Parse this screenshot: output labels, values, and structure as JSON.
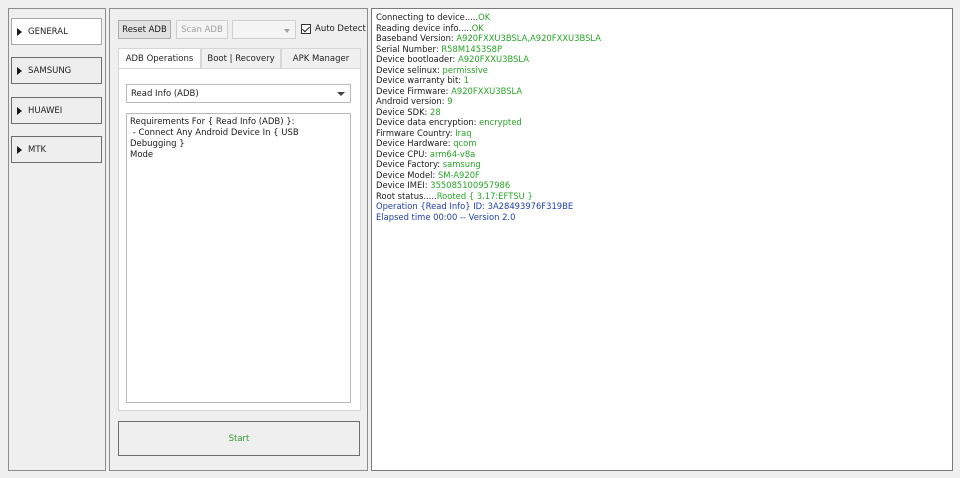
{
  "sidebar": {
    "items": [
      {
        "label": "GENERAL"
      },
      {
        "label": "SAMSUNG"
      },
      {
        "label": "HUAWEI"
      },
      {
        "label": "MTK"
      }
    ]
  },
  "toolbar": {
    "reset_adb": "Reset ADB",
    "scan_adb": "Scan ADB",
    "port_select_value": "",
    "auto_detect_label": "Auto Detect",
    "auto_detect_checked": true
  },
  "tabs": [
    {
      "label": "ADB Operations"
    },
    {
      "label": "Boot | Recovery"
    },
    {
      "label": "APK Manager"
    }
  ],
  "operation": {
    "selected": "Read Info (ADB)",
    "requirements": "Requirements For { Read Info (ADB) }:\n - Connect Any Android Device In { USB Debugging }\nMode"
  },
  "start_button": "Start",
  "colors": {
    "value_green": "#27a427",
    "info_blue": "#1e3fa8",
    "start_green": "#2e9b2e"
  },
  "log": {
    "lines": [
      {
        "label": "Connecting to device.....",
        "value": "OK"
      },
      {
        "label": "Reading device info.....",
        "value": "OK"
      },
      {
        "label": "Baseband Version: ",
        "value": "A920FXXU3BSLA,A920FXXU3BSLA"
      },
      {
        "label": "Serial Number: ",
        "value": "R58M1453S8P"
      },
      {
        "label": "Device bootloader: ",
        "value": "A920FXXU3BSLA"
      },
      {
        "label": "Device selinux: ",
        "value": "permissive"
      },
      {
        "label": "Device warranty bit: ",
        "value": "1"
      },
      {
        "label": "Device Firmware: ",
        "value": "A920FXXU3BSLA"
      },
      {
        "label": "Android version: ",
        "value": "9"
      },
      {
        "label": "Device SDK: ",
        "value": "28"
      },
      {
        "label": "Device data encryption: ",
        "value": "encrypted"
      },
      {
        "label": "Firmware Country: ",
        "value": "Iraq"
      },
      {
        "label": "Device Hardware: ",
        "value": "qcom"
      },
      {
        "label": "Device CPU: ",
        "value": "arm64-v8a"
      },
      {
        "label": "Device Factory: ",
        "value": "samsung"
      },
      {
        "label": "Device Model: ",
        "value": "SM-A920F"
      },
      {
        "label": "Device IMEI: ",
        "value": "355085100957986"
      },
      {
        "label": "Root status.....",
        "value": "Rooted { 3.17:EFTSU }"
      }
    ],
    "operation_line": "Operation {Read Info} ID: 3A28493976F319BE",
    "elapsed_line": "Elapsed time 00:00 -- Version 2.0"
  }
}
